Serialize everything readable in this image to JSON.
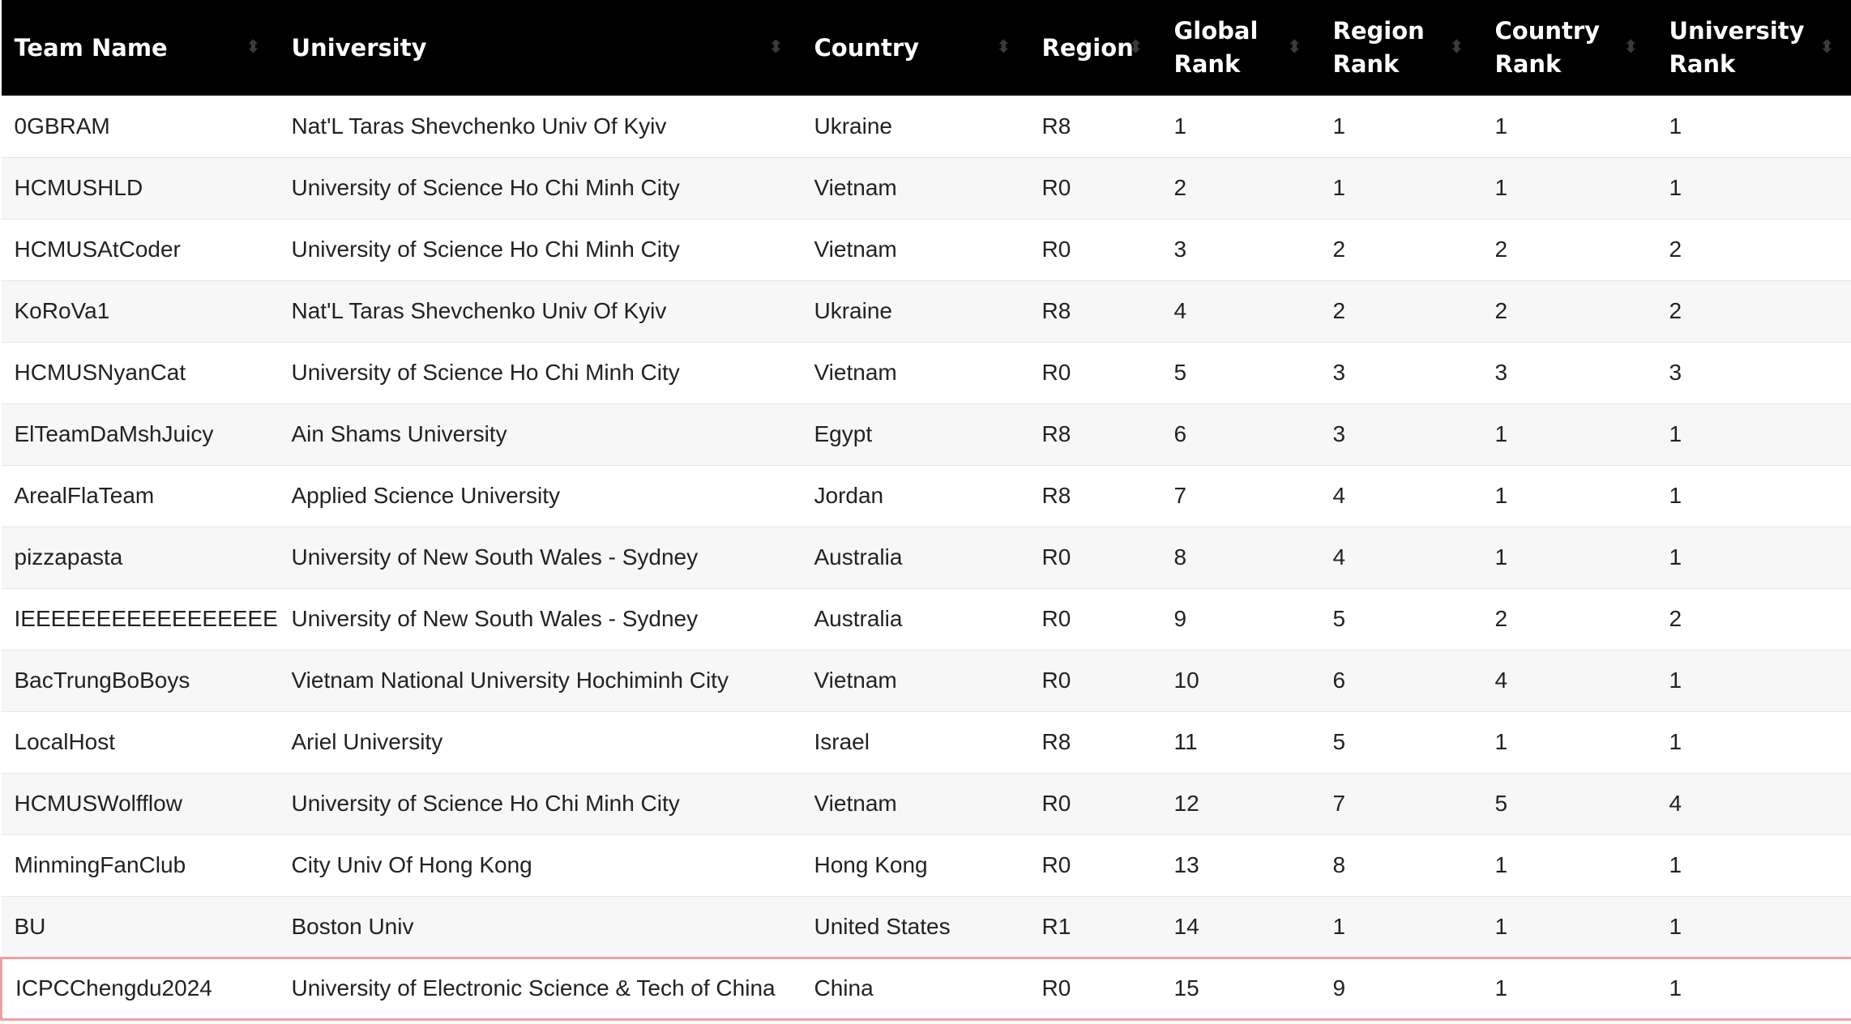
{
  "table": {
    "columns": [
      "Team Name",
      "University",
      "Country",
      "Region",
      "Global Rank",
      "Region Rank",
      "Country Rank",
      "University Rank"
    ],
    "rows": [
      {
        "team": "0GBRAM",
        "university": "Nat'L Taras Shevchenko Univ Of Kyiv",
        "country": "Ukraine",
        "region": "R8",
        "global_rank": "1",
        "region_rank": "1",
        "country_rank": "1",
        "university_rank": "1"
      },
      {
        "team": "HCMUSHLD",
        "university": "University of Science Ho Chi Minh City",
        "country": "Vietnam",
        "region": "R0",
        "global_rank": "2",
        "region_rank": "1",
        "country_rank": "1",
        "university_rank": "1"
      },
      {
        "team": "HCMUSAtCoder",
        "university": "University of Science Ho Chi Minh City",
        "country": "Vietnam",
        "region": "R0",
        "global_rank": "3",
        "region_rank": "2",
        "country_rank": "2",
        "university_rank": "2"
      },
      {
        "team": "KoRoVa1",
        "university": "Nat'L Taras Shevchenko Univ Of Kyiv",
        "country": "Ukraine",
        "region": "R8",
        "global_rank": "4",
        "region_rank": "2",
        "country_rank": "2",
        "university_rank": "2"
      },
      {
        "team": "HCMUSNyanCat",
        "university": "University of Science Ho Chi Minh City",
        "country": "Vietnam",
        "region": "R0",
        "global_rank": "5",
        "region_rank": "3",
        "country_rank": "3",
        "university_rank": "3"
      },
      {
        "team": "ElTeamDaMshJuicy",
        "university": "Ain Shams University",
        "country": "Egypt",
        "region": "R8",
        "global_rank": "6",
        "region_rank": "3",
        "country_rank": "1",
        "university_rank": "1"
      },
      {
        "team": "ArealFlaTeam",
        "university": "Applied Science University",
        "country": "Jordan",
        "region": "R8",
        "global_rank": "7",
        "region_rank": "4",
        "country_rank": "1",
        "university_rank": "1"
      },
      {
        "team": "pizzapasta",
        "university": "University of New South Wales - Sydney",
        "country": "Australia",
        "region": "R0",
        "global_rank": "8",
        "region_rank": "4",
        "country_rank": "1",
        "university_rank": "1"
      },
      {
        "team": "IEEEEEEEEEEEEEEEEEE",
        "university": "University of New South Wales - Sydney",
        "country": "Australia",
        "region": "R0",
        "global_rank": "9",
        "region_rank": "5",
        "country_rank": "2",
        "university_rank": "2"
      },
      {
        "team": "BacTrungBoBoys",
        "university": "Vietnam National University Hochiminh City",
        "country": "Vietnam",
        "region": "R0",
        "global_rank": "10",
        "region_rank": "6",
        "country_rank": "4",
        "university_rank": "1"
      },
      {
        "team": "LocalHost",
        "university": "Ariel University",
        "country": "Israel",
        "region": "R8",
        "global_rank": "11",
        "region_rank": "5",
        "country_rank": "1",
        "university_rank": "1"
      },
      {
        "team": "HCMUSWolfflow",
        "university": "University of Science Ho Chi Minh City",
        "country": "Vietnam",
        "region": "R0",
        "global_rank": "12",
        "region_rank": "7",
        "country_rank": "5",
        "university_rank": "4"
      },
      {
        "team": "MinmingFanClub",
        "university": "City Univ Of Hong Kong",
        "country": "Hong Kong",
        "region": "R0",
        "global_rank": "13",
        "region_rank": "8",
        "country_rank": "1",
        "university_rank": "1"
      },
      {
        "team": "BU",
        "university": "Boston Univ",
        "country": "United States",
        "region": "R1",
        "global_rank": "14",
        "region_rank": "1",
        "country_rank": "1",
        "university_rank": "1"
      },
      {
        "team": "ICPCChengdu2024",
        "university": "University of Electronic Science & Tech of China",
        "country": "China",
        "region": "R0",
        "global_rank": "15",
        "region_rank": "9",
        "country_rank": "1",
        "university_rank": "1",
        "highlighted": true
      }
    ]
  },
  "colors": {
    "header_bg": "#000000",
    "header_text": "#ffffff",
    "highlight_border": "#f0a0a0",
    "stripe": "#f7f7f7"
  },
  "icons": {
    "sort": "sort-icon"
  }
}
